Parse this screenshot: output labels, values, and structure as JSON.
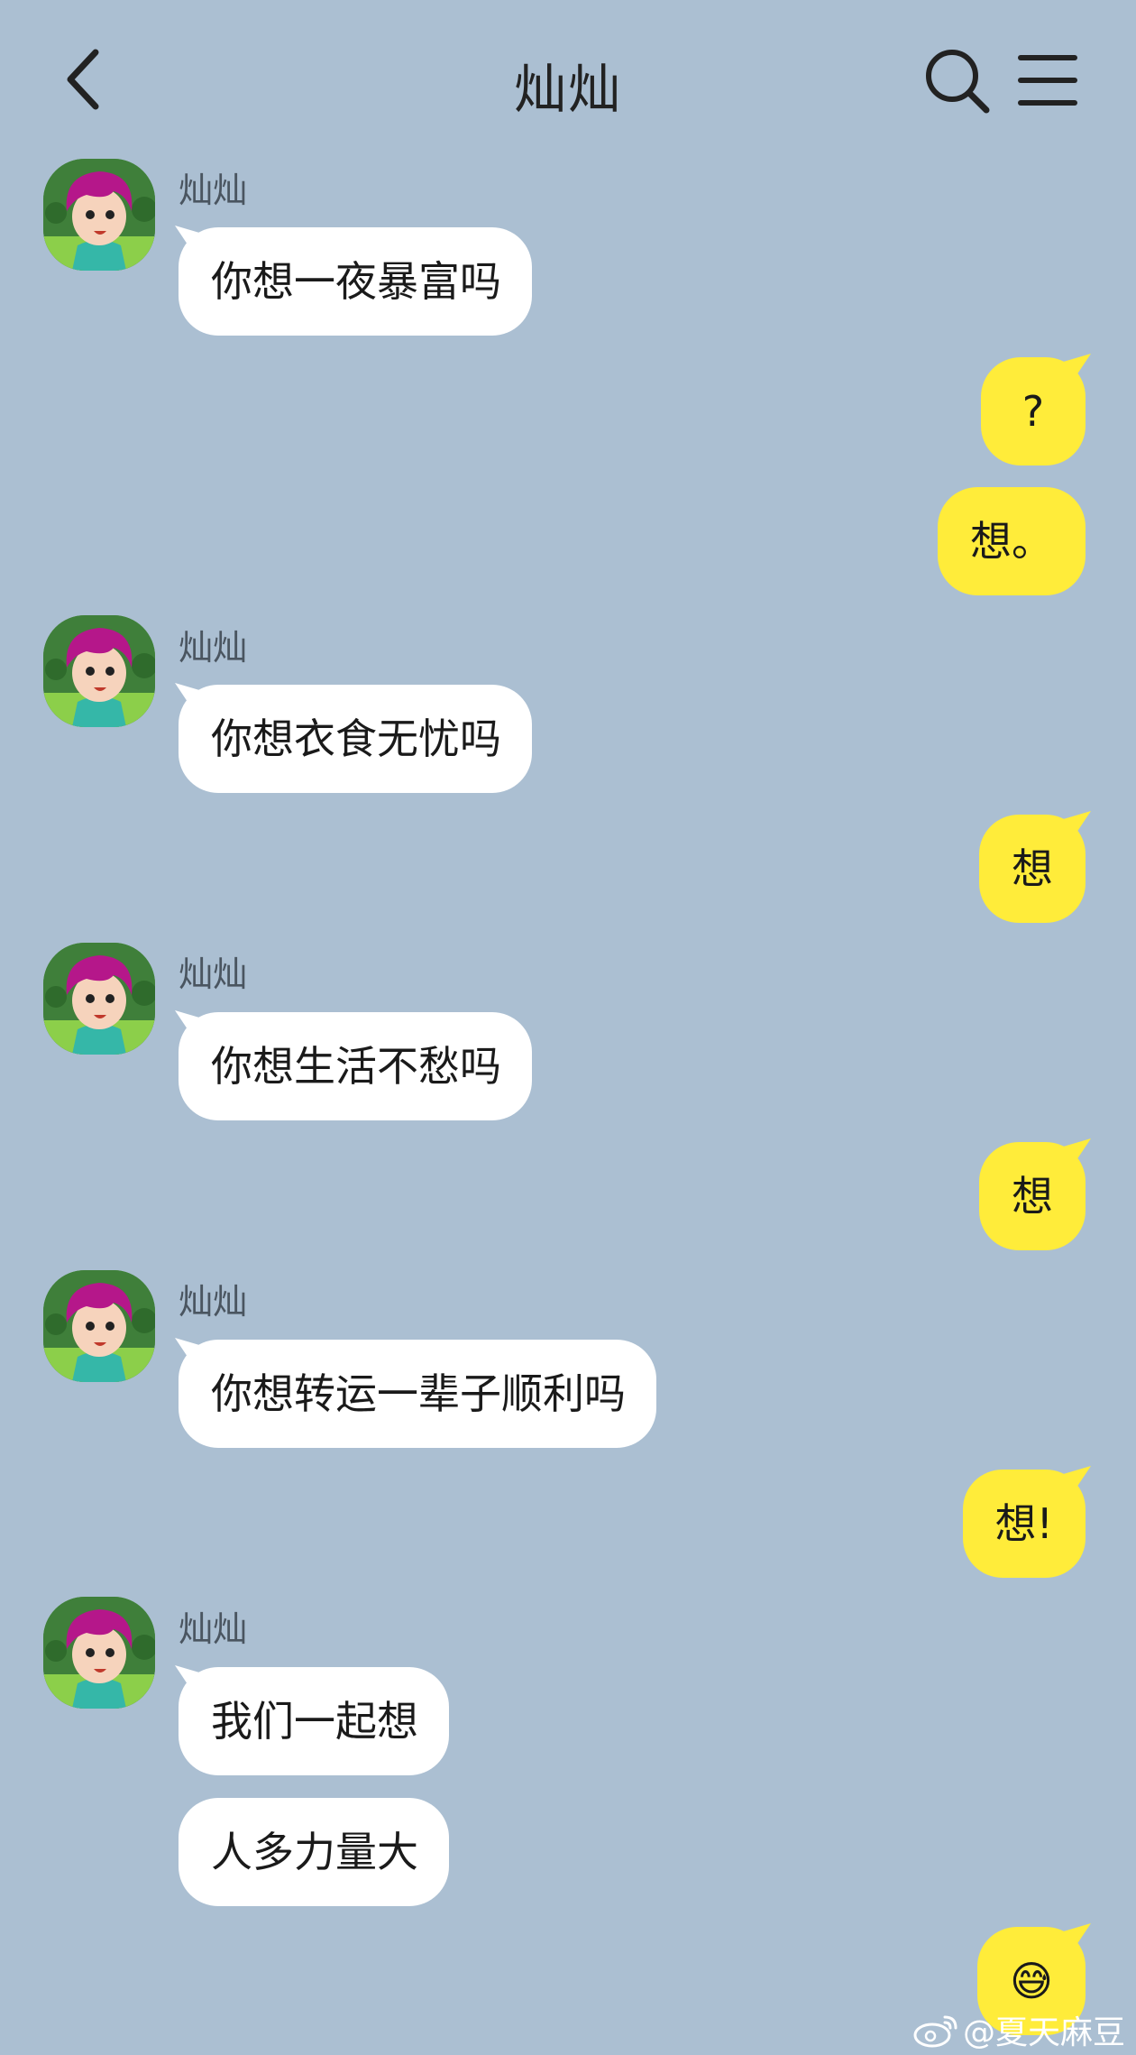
{
  "header": {
    "title": "灿灿",
    "back_icon": "chevron-left-icon",
    "search_icon": "search-icon",
    "menu_icon": "hamburger-menu-icon"
  },
  "contact": {
    "name": "灿灿",
    "avatar": "cartoon-girl-avatar"
  },
  "messages": [
    {
      "from": "them",
      "text": "你想一夜暴富吗"
    },
    {
      "from": "me",
      "text": "?"
    },
    {
      "from": "me",
      "text": "想。"
    },
    {
      "from": "them",
      "text": "你想衣食无忧吗"
    },
    {
      "from": "me",
      "text": "想"
    },
    {
      "from": "them",
      "text": "你想生活不愁吗"
    },
    {
      "from": "me",
      "text": "想"
    },
    {
      "from": "them",
      "text": "你想转运一辈子顺利吗"
    },
    {
      "from": "me",
      "text": "想!"
    },
    {
      "from": "them",
      "text": "我们一起想"
    },
    {
      "from": "them",
      "text": "人多力量大"
    },
    {
      "from": "me",
      "text": "😅"
    }
  ],
  "watermark": {
    "text": "@夏天麻豆",
    "icon": "weibo-logo-icon"
  },
  "colors": {
    "background": "#abbfd2",
    "incoming_bubble": "#ffffff",
    "outgoing_bubble": "#ffec3a"
  }
}
